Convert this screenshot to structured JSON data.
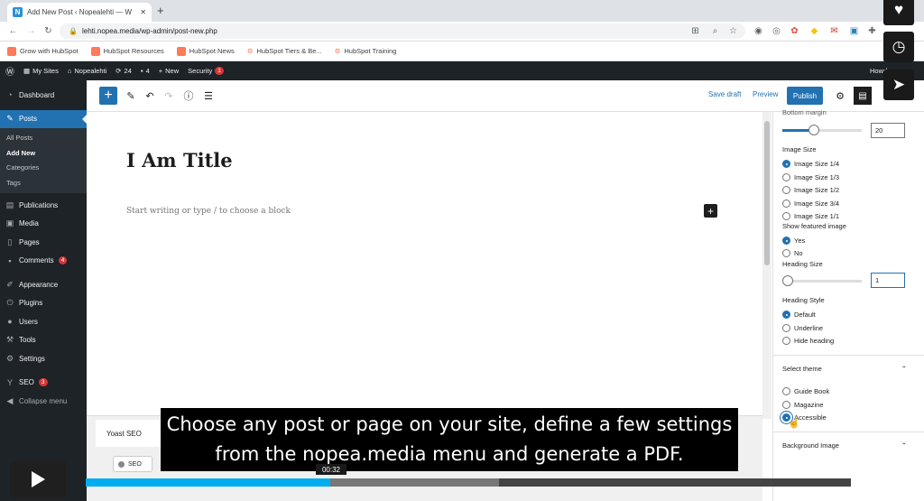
{
  "browser": {
    "tab_title": "Add New Post ‹ Nopealehti — W",
    "url": "lehti.nopea.media/wp-admin/post-new.php",
    "bookmarks": [
      "Grow with HubSpot",
      "HubSpot Resources",
      "HubSpot News",
      "HubSpot Tiers & Be...",
      "HubSpot Training"
    ]
  },
  "adminbar": {
    "my_sites": "My Sites",
    "site": "Nopealehti",
    "updates": "24",
    "comments": "4",
    "new": "New",
    "security": "Security",
    "security_badge": "1",
    "howdy": "Howdy"
  },
  "sidebar": {
    "dashboard": "Dashboard",
    "posts": "Posts",
    "posts_sub": [
      "All Posts",
      "Add New",
      "Categories",
      "Tags"
    ],
    "publications": "Publications",
    "media": "Media",
    "pages": "Pages",
    "comments": "Comments",
    "comments_badge": "4",
    "appearance": "Appearance",
    "plugins": "Plugins",
    "users": "Users",
    "tools": "Tools",
    "settings": "Settings",
    "seo": "SEO",
    "seo_badge": "3",
    "collapse": "Collapse menu"
  },
  "editor": {
    "save_draft": "Save draft",
    "preview": "Preview",
    "publish": "Publish",
    "title": "I Am Title",
    "placeholder": "Start writing or type / to choose a block"
  },
  "panel": {
    "bottom_margin_label": "Bottom margin",
    "bottom_margin_value": "20",
    "bottom_margin_fraction": 0.4,
    "image_size_label": "Image Size",
    "image_sizes": [
      "Image Size 1/4",
      "Image Size 1/3",
      "Image Size 1/2",
      "Image Size 3/4",
      "Image Size 1/1"
    ],
    "show_featured_label": "Show featured image",
    "featured_options": [
      "Yes",
      "No"
    ],
    "heading_size_label": "Heading Size",
    "heading_size_value": "1",
    "heading_size_fraction": 0.0,
    "heading_style_label": "Heading Style",
    "heading_styles": [
      "Default",
      "Underline",
      "Hide heading"
    ],
    "select_theme_label": "Select theme",
    "themes": [
      "Guide Book",
      "Magazine",
      "Accessible"
    ],
    "background_image_label": "Background Image"
  },
  "yoast": {
    "title": "Yoast SEO",
    "seo_tab": "SEO"
  },
  "video": {
    "subtitle": "Choose any post or page on your site, define a few settings from the nopea.media menu and generate a PDF.",
    "time": "00:32",
    "played_fraction": 0.32,
    "buffered_fraction": 0.54
  }
}
